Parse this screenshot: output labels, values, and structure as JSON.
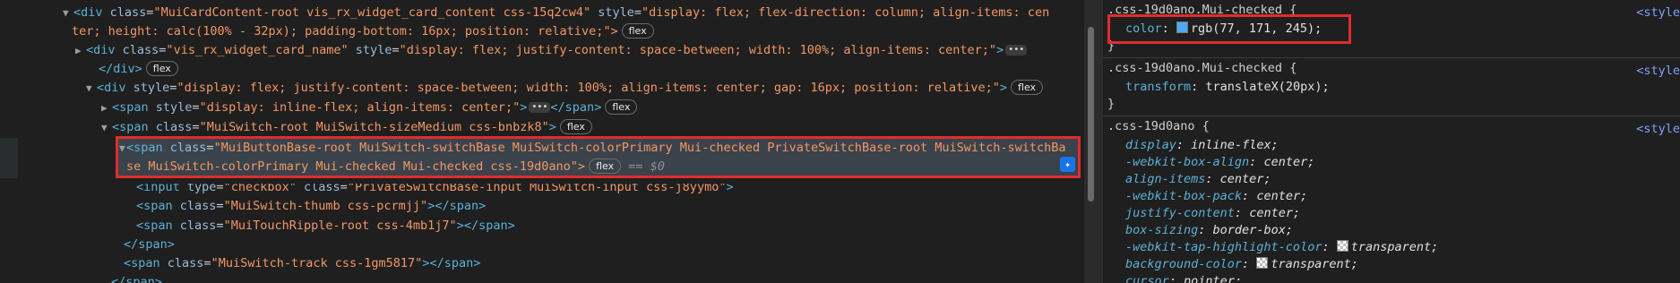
{
  "elements": {
    "lines": [
      {
        "tri": "▼",
        "tag": "div",
        "attrs": [
          [
            "class",
            "MuiCardContent-root vis_rx_widget_card_content css-15q2cw4"
          ],
          [
            "style",
            "display: flex; flex-direction: column; align-items: cen"
          ]
        ],
        "suffix": ""
      },
      {
        "tri": "",
        "text1": "ter; height: calc(100% - 32px); padding-bottom: 16px; position: relative;",
        "text2": "\">",
        "badge": "flex"
      },
      {
        "tri": "▶",
        "tag": "div",
        "attrs": [
          [
            "class",
            "vis_rx_widget_card_name"
          ],
          [
            "style",
            "display: flex; justify-content: space-between; width: 100%; align-items: center;"
          ]
        ],
        "dots": "•••"
      },
      {
        "close": "</div>",
        "badge": "flex"
      },
      {
        "tri": "▼",
        "tag": "div",
        "attrs": [
          [
            "style",
            "display: flex; justify-content: space-between; width: 100%; align-items: center; gap: 16px; position: relative;"
          ]
        ],
        "badge": "flex"
      },
      {
        "tri": "▶",
        "tag": "span",
        "attrs": [
          [
            "style",
            "display: inline-flex; align-items: center;"
          ]
        ],
        "dots": "•••",
        "close": "</span>",
        "badge": "flex"
      },
      {
        "tri": "▼",
        "tag": "span",
        "attrs": [
          [
            "class",
            "MuiSwitch-root MuiSwitch-sizeMedium css-bnbzk8"
          ]
        ],
        "badge": "flex"
      },
      {
        "tri": "▼",
        "tag": "span",
        "attrs": [
          [
            "class",
            "MuiButtonBase-root MuiSwitch-switchBase MuiSwitch-colorPrimary Mui-checked PrivateSwitchBase-root MuiSwitch-switchBa"
          ]
        ]
      },
      {
        "text1": "se MuiSwitch-colorPrimary Mui-checked Mui-checked css-19d0ano",
        "text2": "\">",
        "badge": "flex",
        "eq": "==",
        "dollar": "$0"
      },
      {
        "tag": "input",
        "attrs": [
          [
            "type",
            "checkbox"
          ],
          [
            "class",
            "PrivateSwitchBase-input MuiSwitch-input css-j8yymo"
          ]
        ]
      },
      {
        "tag": "span",
        "attrs": [
          [
            "class",
            "MuiSwitch-thumb css-pcrmjj"
          ]
        ],
        "close": "</span>"
      },
      {
        "tag": "span",
        "attrs": [
          [
            "class",
            "MuiTouchRipple-root css-4mb1j7"
          ]
        ],
        "close": "</span>"
      },
      {
        "close": "</span>"
      },
      {
        "tag": "span",
        "attrs": [
          [
            "class",
            "MuiSwitch-track css-1gm5817"
          ]
        ],
        "close": "</span>"
      },
      {
        "close": "</span>"
      }
    ]
  },
  "styles": {
    "rules": [
      {
        "selector": ".css-19d0ano.Mui-checked {",
        "source": "<style",
        "decls": [
          {
            "prop": "color",
            "value": "rgb(77, 171, 245)",
            "swatch": "#4dabf5"
          }
        ],
        "close": "}"
      },
      {
        "selector": ".css-19d0ano.Mui-checked {",
        "source": "<style",
        "decls": [
          {
            "prop": "transform",
            "value": "translateX(20px)"
          }
        ],
        "close": "}"
      },
      {
        "selector": ".css-19d0ano {",
        "source": "<style",
        "decls": [
          {
            "prop": "display",
            "value": "inline-flex"
          },
          {
            "prop": "-webkit-box-align",
            "value": "center"
          },
          {
            "prop": "align-items",
            "value": "center"
          },
          {
            "prop": "-webkit-box-pack",
            "value": "center"
          },
          {
            "prop": "justify-content",
            "value": "center"
          },
          {
            "prop": "box-sizing",
            "value": "border-box"
          },
          {
            "prop": "-webkit-tap-highlight-color",
            "value": "transparent",
            "checker": true
          },
          {
            "prop": "background-color",
            "value": "transparent",
            "checker": true
          },
          {
            "prop": "cursor",
            "value": "pointer"
          }
        ]
      }
    ]
  },
  "colors": {
    "highlight": "#e02c2c",
    "selected_row": "#3a434b",
    "swatch": "#4dabf5"
  },
  "icons": {
    "ai_assist": "ai-assistance-icon"
  }
}
